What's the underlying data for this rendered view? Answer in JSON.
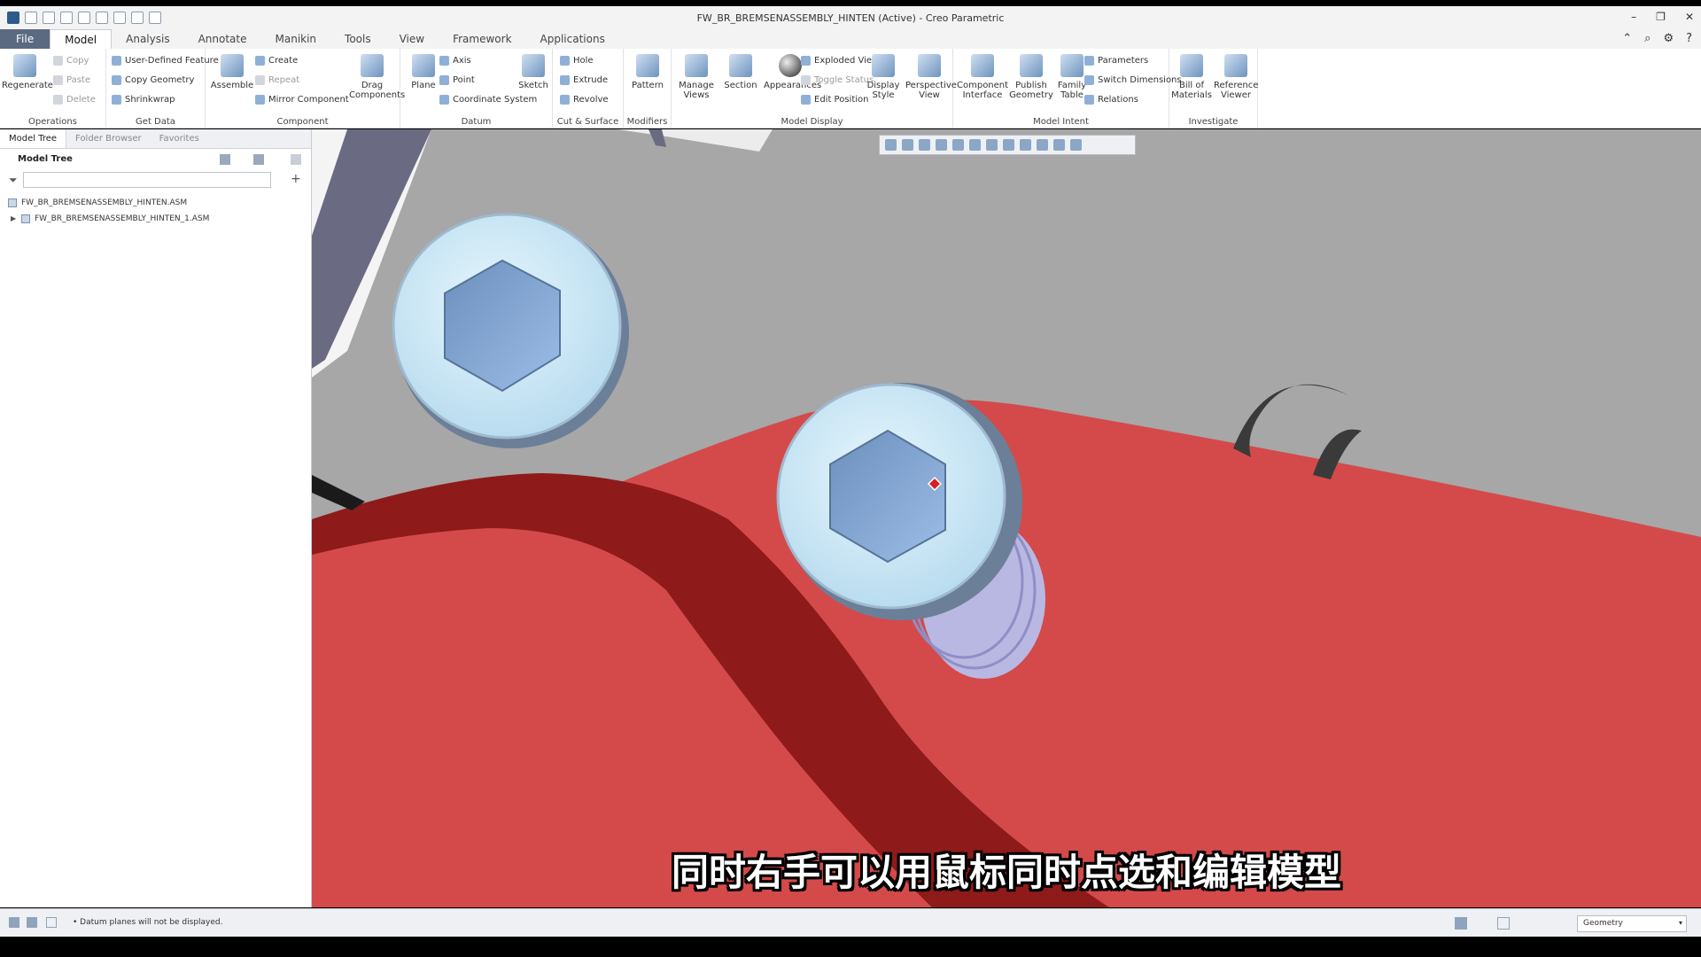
{
  "window": {
    "title": "FW_BR_BREMSENASSEMBLY_HINTEN (Active) - Creo Parametric",
    "minimize": "–",
    "restore": "❐",
    "close": "✕"
  },
  "menu_tabs": [
    "File",
    "Model",
    "Analysis",
    "Annotate",
    "Manikin",
    "Tools",
    "View",
    "Framework",
    "Applications"
  ],
  "active_tab": "Model",
  "ribbon": {
    "operations": {
      "label": "Operations",
      "regenerate": "Regenerate",
      "copy": "Copy",
      "paste": "Paste",
      "delete": "Delete"
    },
    "get_data": {
      "label": "Get Data",
      "udf": "User-Defined Feature",
      "copy_geometry": "Copy Geometry",
      "shrinkwrap": "Shrinkwrap"
    },
    "component": {
      "label": "Component",
      "assemble": "Assemble",
      "create": "Create",
      "repeat": "Repeat",
      "mirror": "Mirror Component",
      "drag": "Drag Components"
    },
    "datum": {
      "label": "Datum",
      "plane": "Plane",
      "axis": "Axis",
      "point": "Point",
      "csys": "Coordinate System",
      "sketch": "Sketch"
    },
    "cut_surface": {
      "label": "Cut & Surface",
      "hole": "Hole",
      "extrude": "Extrude",
      "revolve": "Revolve"
    },
    "modifiers": {
      "label": "Modifiers",
      "pattern": "Pattern"
    },
    "model_display": {
      "label": "Model Display",
      "manage_views": "Manage Views",
      "section": "Section",
      "appearances": "Appearances",
      "exploded_view": "Exploded View",
      "toggle_status": "Toggle Status",
      "edit_position": "Edit Position",
      "display_style": "Display Style",
      "perspective_view": "Perspective View"
    },
    "model_intent": {
      "label": "Model Intent",
      "component_interface": "Component Interface",
      "publish_geometry": "Publish Geometry",
      "family_table": "Family Table",
      "parameters": "Parameters",
      "switch_dimensions": "Switch Dimensions",
      "relations": "Relations"
    },
    "investigate": {
      "label": "Investigate",
      "bom": "Bill of Materials",
      "reference_viewer": "Reference Viewer"
    }
  },
  "left_panel": {
    "tabs": [
      "Model Tree",
      "Folder Browser",
      "Favorites"
    ],
    "header": "Model Tree",
    "search_value": "",
    "items": [
      "FW_BR_BREMSENASSEMBLY_HINTEN.ASM",
      "FW_BR_BREMSENASSEMBLY_HINTEN_1.ASM"
    ]
  },
  "viewport": {
    "subtitle": "同时右手可以用鼠标同时点选和编辑模型",
    "colors": {
      "background": "#a8a8a8",
      "part": "#d64545",
      "bolt": "#cfeaf7"
    }
  },
  "status": {
    "message": "• Datum planes will not be displayed.",
    "filter_value": "Geometry"
  }
}
